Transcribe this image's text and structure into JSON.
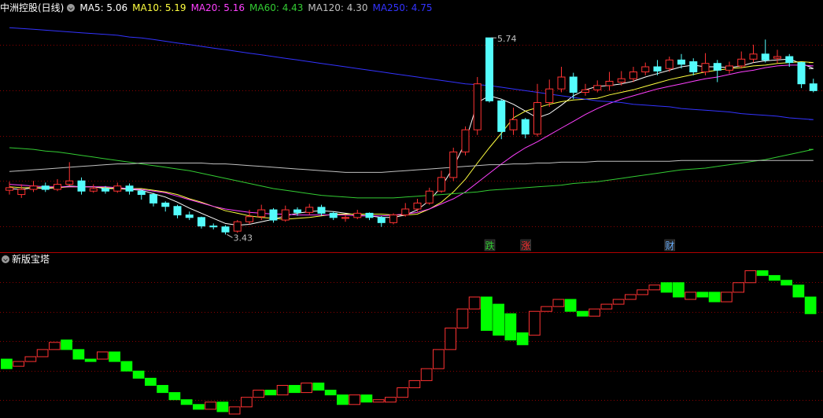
{
  "header": {
    "stock_title": "中洲控股(日线)",
    "indicators": [
      {
        "label": "MA5: 5.06",
        "color": "#ffffff"
      },
      {
        "label": "MA10: 5.19",
        "color": "#ffff40"
      },
      {
        "label": "MA20: 5.16",
        "color": "#ff40ff"
      },
      {
        "label": "MA60: 4.43",
        "color": "#33cc33"
      },
      {
        "label": "MA120: 4.30",
        "color": "#c0c0c0"
      },
      {
        "label": "MA250: 4.75",
        "color": "#3333ff"
      }
    ]
  },
  "sub_panel": {
    "title": "新版宝塔"
  },
  "colors": {
    "up": "#ff3232",
    "down": "#54fcfc",
    "tower_up": "#ff3232",
    "tower_down": "#00ff00",
    "grid": "#8b0000",
    "marker_die": "#33cc33",
    "marker_zhang": "#ff3232",
    "marker_cai": "#6ab0ff"
  },
  "chart_data": [
    {
      "type": "candlestick",
      "title": "中洲控股(日线)",
      "ylim": [
        3.25,
        6.0
      ],
      "annotations": {
        "high": "5.74",
        "low": "3.43"
      },
      "markers": [
        {
          "label": "跌",
          "index": 40
        },
        {
          "label": "涨",
          "index": 43
        },
        {
          "label": "财",
          "index": 55
        }
      ],
      "candles": [
        [
          3.95,
          3.98,
          4.05,
          3.9
        ],
        [
          3.9,
          3.96,
          4.02,
          3.86
        ],
        [
          3.96,
          4.0,
          4.06,
          3.93
        ],
        [
          4.0,
          3.96,
          4.04,
          3.93
        ],
        [
          3.96,
          4.02,
          4.08,
          3.94
        ],
        [
          4.02,
          4.06,
          4.28,
          4.0
        ],
        [
          4.06,
          3.94,
          4.1,
          3.9
        ],
        [
          3.94,
          3.97,
          4.02,
          3.92
        ],
        [
          3.97,
          3.94,
          4.0,
          3.91
        ],
        [
          3.94,
          4.0,
          4.04,
          3.92
        ],
        [
          4.0,
          3.94,
          4.03,
          3.9
        ],
        [
          3.94,
          3.9,
          3.96,
          3.84
        ],
        [
          3.9,
          3.8,
          3.92,
          3.76
        ],
        [
          3.8,
          3.76,
          3.82,
          3.7
        ],
        [
          3.76,
          3.66,
          3.78,
          3.62
        ],
        [
          3.66,
          3.63,
          3.7,
          3.6
        ],
        [
          3.63,
          3.53,
          3.64,
          3.5
        ],
        [
          3.53,
          3.52,
          3.56,
          3.49
        ],
        [
          3.52,
          3.46,
          3.54,
          3.43
        ],
        [
          3.47,
          3.58,
          3.6,
          3.45
        ],
        [
          3.58,
          3.64,
          3.72,
          3.55
        ],
        [
          3.64,
          3.72,
          3.78,
          3.6
        ],
        [
          3.72,
          3.6,
          3.74,
          3.57
        ],
        [
          3.6,
          3.72,
          3.77,
          3.58
        ],
        [
          3.72,
          3.69,
          3.75,
          3.65
        ],
        [
          3.69,
          3.75,
          3.79,
          3.66
        ],
        [
          3.75,
          3.68,
          3.78,
          3.65
        ],
        [
          3.68,
          3.63,
          3.7,
          3.6
        ],
        [
          3.62,
          3.63,
          3.66,
          3.58
        ],
        [
          3.63,
          3.68,
          3.72,
          3.61
        ],
        [
          3.68,
          3.63,
          3.69,
          3.6
        ],
        [
          3.63,
          3.57,
          3.65,
          3.52
        ],
        [
          3.57,
          3.66,
          3.68,
          3.55
        ],
        [
          3.66,
          3.73,
          3.8,
          3.64
        ],
        [
          3.73,
          3.8,
          3.85,
          3.7
        ],
        [
          3.8,
          3.94,
          3.98,
          3.78
        ],
        [
          3.94,
          4.1,
          4.18,
          3.92
        ],
        [
          4.1,
          4.4,
          4.45,
          4.06
        ],
        [
          4.4,
          4.66,
          4.7,
          4.36
        ],
        [
          4.66,
          5.2,
          5.28,
          4.6
        ],
        [
          5.74,
          5.0,
          5.74,
          4.98
        ],
        [
          5.0,
          4.64,
          5.02,
          4.55
        ],
        [
          4.66,
          4.78,
          4.92,
          4.6
        ],
        [
          4.78,
          4.61,
          4.8,
          4.56
        ],
        [
          4.61,
          4.98,
          5.2,
          4.58
        ],
        [
          4.98,
          5.14,
          5.25,
          4.93
        ],
        [
          5.14,
          5.28,
          5.4,
          5.1
        ],
        [
          5.28,
          5.1,
          5.33,
          5.02
        ],
        [
          5.1,
          5.13,
          5.2,
          5.06
        ],
        [
          5.13,
          5.18,
          5.24,
          5.1
        ],
        [
          5.18,
          5.23,
          5.34,
          5.12
        ],
        [
          5.22,
          5.26,
          5.35,
          5.18
        ],
        [
          5.26,
          5.34,
          5.4,
          5.22
        ],
        [
          5.34,
          5.4,
          5.45,
          5.3
        ],
        [
          5.4,
          5.35,
          5.48,
          5.3
        ],
        [
          5.38,
          5.48,
          5.52,
          5.34
        ],
        [
          5.48,
          5.43,
          5.55,
          5.38
        ],
        [
          5.46,
          5.34,
          5.5,
          5.3
        ],
        [
          5.34,
          5.44,
          5.56,
          5.3
        ],
        [
          5.44,
          5.36,
          5.48,
          5.22
        ],
        [
          5.36,
          5.41,
          5.46,
          5.32
        ],
        [
          5.41,
          5.49,
          5.58,
          5.38
        ],
        [
          5.49,
          5.55,
          5.66,
          5.45
        ],
        [
          5.55,
          5.48,
          5.72,
          5.45
        ],
        [
          5.5,
          5.52,
          5.6,
          5.44
        ],
        [
          5.52,
          5.45,
          5.55,
          5.4
        ],
        [
          5.45,
          5.2,
          5.46,
          5.15
        ],
        [
          5.2,
          5.12,
          5.26,
          5.1
        ]
      ],
      "series": [
        {
          "name": "MA5",
          "color": "#ffffff",
          "values": [
            3.97,
            3.96,
            3.98,
            3.97,
            3.98,
            4.0,
            3.99,
            3.99,
            3.97,
            3.97,
            3.96,
            3.95,
            3.91,
            3.87,
            3.81,
            3.74,
            3.68,
            3.62,
            3.56,
            3.54,
            3.55,
            3.58,
            3.61,
            3.65,
            3.68,
            3.7,
            3.71,
            3.7,
            3.68,
            3.66,
            3.65,
            3.63,
            3.63,
            3.66,
            3.72,
            3.83,
            3.99,
            4.22,
            4.52,
            4.98,
            5.06,
            5.02,
            4.96,
            4.88,
            4.8,
            4.85,
            4.95,
            5.06,
            5.13,
            5.17,
            5.18,
            5.2,
            5.23,
            5.28,
            5.32,
            5.36,
            5.4,
            5.42,
            5.4,
            5.4,
            5.39,
            5.41,
            5.45,
            5.47,
            5.48,
            5.49,
            5.44,
            5.38
          ]
        },
        {
          "name": "MA10",
          "color": "#ffff40",
          "values": [
            3.99,
            3.98,
            3.98,
            3.98,
            3.98,
            3.99,
            3.99,
            3.99,
            3.98,
            3.97,
            3.97,
            3.97,
            3.95,
            3.93,
            3.9,
            3.85,
            3.81,
            3.76,
            3.71,
            3.68,
            3.65,
            3.63,
            3.62,
            3.61,
            3.62,
            3.63,
            3.65,
            3.67,
            3.67,
            3.67,
            3.67,
            3.67,
            3.66,
            3.66,
            3.67,
            3.73,
            3.81,
            3.93,
            4.08,
            4.27,
            4.45,
            4.62,
            4.8,
            4.88,
            4.92,
            4.96,
            4.99,
            5.01,
            5.02,
            5.03,
            5.07,
            5.1,
            5.13,
            5.17,
            5.21,
            5.25,
            5.28,
            5.31,
            5.34,
            5.36,
            5.38,
            5.39,
            5.41,
            5.42,
            5.44,
            5.45,
            5.46,
            5.45
          ]
        },
        {
          "name": "MA20",
          "color": "#ff40ff",
          "values": [
            4.02,
            4.01,
            4.0,
            3.99,
            3.99,
            3.99,
            3.99,
            3.99,
            3.99,
            3.98,
            3.97,
            3.96,
            3.94,
            3.92,
            3.88,
            3.84,
            3.8,
            3.76,
            3.73,
            3.71,
            3.69,
            3.68,
            3.67,
            3.67,
            3.66,
            3.66,
            3.66,
            3.66,
            3.66,
            3.65,
            3.65,
            3.65,
            3.66,
            3.67,
            3.69,
            3.73,
            3.79,
            3.85,
            3.93,
            4.04,
            4.15,
            4.26,
            4.36,
            4.45,
            4.52,
            4.6,
            4.68,
            4.76,
            4.84,
            4.91,
            4.97,
            5.02,
            5.06,
            5.1,
            5.14,
            5.17,
            5.2,
            5.23,
            5.26,
            5.28,
            5.31,
            5.34,
            5.36,
            5.39,
            5.41,
            5.42,
            5.42,
            5.41
          ]
        },
        {
          "name": "MA60",
          "color": "#33cc33",
          "values": [
            4.45,
            4.44,
            4.43,
            4.41,
            4.4,
            4.38,
            4.36,
            4.34,
            4.32,
            4.3,
            4.28,
            4.26,
            4.24,
            4.22,
            4.2,
            4.18,
            4.15,
            4.12,
            4.09,
            4.06,
            4.03,
            4.0,
            3.97,
            3.95,
            3.93,
            3.91,
            3.89,
            3.88,
            3.87,
            3.86,
            3.86,
            3.86,
            3.86,
            3.87,
            3.88,
            3.89,
            3.9,
            3.91,
            3.92,
            3.93,
            3.95,
            3.96,
            3.97,
            3.98,
            3.99,
            4.0,
            4.01,
            4.03,
            4.04,
            4.05,
            4.07,
            4.09,
            4.11,
            4.13,
            4.15,
            4.17,
            4.19,
            4.2,
            4.21,
            4.23,
            4.25,
            4.27,
            4.29,
            4.31,
            4.34,
            4.37,
            4.4,
            4.43
          ]
        },
        {
          "name": "MA120",
          "color": "#c0c0c0",
          "values": [
            4.17,
            4.18,
            4.19,
            4.2,
            4.21,
            4.22,
            4.23,
            4.24,
            4.25,
            4.26,
            4.26,
            4.27,
            4.27,
            4.27,
            4.27,
            4.27,
            4.27,
            4.26,
            4.26,
            4.25,
            4.24,
            4.23,
            4.22,
            4.21,
            4.2,
            4.19,
            4.18,
            4.17,
            4.16,
            4.16,
            4.16,
            4.16,
            4.17,
            4.18,
            4.19,
            4.2,
            4.21,
            4.22,
            4.23,
            4.24,
            4.25,
            4.25,
            4.26,
            4.26,
            4.27,
            4.27,
            4.28,
            4.28,
            4.28,
            4.29,
            4.29,
            4.29,
            4.29,
            4.29,
            4.29,
            4.29,
            4.3,
            4.3,
            4.3,
            4.3,
            4.3,
            4.3,
            4.3,
            4.3,
            4.3,
            4.3,
            4.3,
            4.3
          ]
        },
        {
          "name": "MA250",
          "color": "#3333ff",
          "values": [
            5.86,
            5.85,
            5.84,
            5.83,
            5.82,
            5.81,
            5.8,
            5.79,
            5.78,
            5.77,
            5.75,
            5.74,
            5.72,
            5.7,
            5.68,
            5.66,
            5.64,
            5.62,
            5.6,
            5.58,
            5.56,
            5.54,
            5.52,
            5.5,
            5.48,
            5.46,
            5.44,
            5.42,
            5.4,
            5.38,
            5.36,
            5.34,
            5.32,
            5.3,
            5.28,
            5.26,
            5.24,
            5.22,
            5.2,
            5.19,
            5.18,
            5.16,
            5.14,
            5.12,
            5.1,
            5.08,
            5.06,
            5.04,
            5.02,
            5.0,
            4.99,
            4.98,
            4.96,
            4.95,
            4.94,
            4.93,
            4.91,
            4.9,
            4.89,
            4.88,
            4.87,
            4.85,
            4.84,
            4.83,
            4.82,
            4.8,
            4.79,
            4.78
          ]
        }
      ]
    },
    {
      "type": "tower",
      "title": "新版宝塔",
      "ylim": [
        0,
        100
      ],
      "bricks": [
        [
          48,
          40
        ],
        [
          42,
          46
        ],
        [
          46,
          50
        ],
        [
          50,
          56
        ],
        [
          56,
          62
        ],
        [
          64,
          56
        ],
        [
          56,
          48
        ],
        [
          48,
          46
        ],
        [
          48,
          54
        ],
        [
          54,
          46
        ],
        [
          46,
          38
        ],
        [
          38,
          32
        ],
        [
          32,
          26
        ],
        [
          26,
          20
        ],
        [
          20,
          14
        ],
        [
          14,
          10
        ],
        [
          10,
          6
        ],
        [
          6,
          12
        ],
        [
          12,
          4
        ],
        [
          2,
          8
        ],
        [
          8,
          16
        ],
        [
          16,
          22
        ],
        [
          22,
          18
        ],
        [
          18,
          26
        ],
        [
          26,
          20
        ],
        [
          20,
          28
        ],
        [
          28,
          22
        ],
        [
          22,
          18
        ],
        [
          18,
          10
        ],
        [
          10,
          18
        ],
        [
          18,
          12
        ],
        [
          12,
          14
        ],
        [
          12,
          16
        ],
        [
          16,
          24
        ],
        [
          24,
          30
        ],
        [
          30,
          40
        ],
        [
          40,
          56
        ],
        [
          56,
          74
        ],
        [
          74,
          90
        ],
        [
          90,
          100
        ],
        [
          100,
          72
        ],
        [
          94,
          68
        ],
        [
          86,
          64
        ],
        [
          70,
          60
        ],
        [
          68,
          88
        ],
        [
          88,
          92
        ],
        [
          92,
          98
        ],
        [
          98,
          88
        ],
        [
          88,
          84
        ],
        [
          84,
          90
        ],
        [
          90,
          94
        ],
        [
          94,
          98
        ],
        [
          98,
          102
        ],
        [
          102,
          106
        ],
        [
          106,
          110
        ],
        [
          112,
          104
        ],
        [
          112,
          100
        ],
        [
          98,
          104
        ],
        [
          104,
          100
        ],
        [
          104,
          96
        ],
        [
          96,
          104
        ],
        [
          104,
          112
        ],
        [
          112,
          122
        ],
        [
          122,
          118
        ],
        [
          118,
          114
        ],
        [
          114,
          110
        ],
        [
          110,
          100
        ],
        [
          100,
          86
        ]
      ]
    }
  ]
}
